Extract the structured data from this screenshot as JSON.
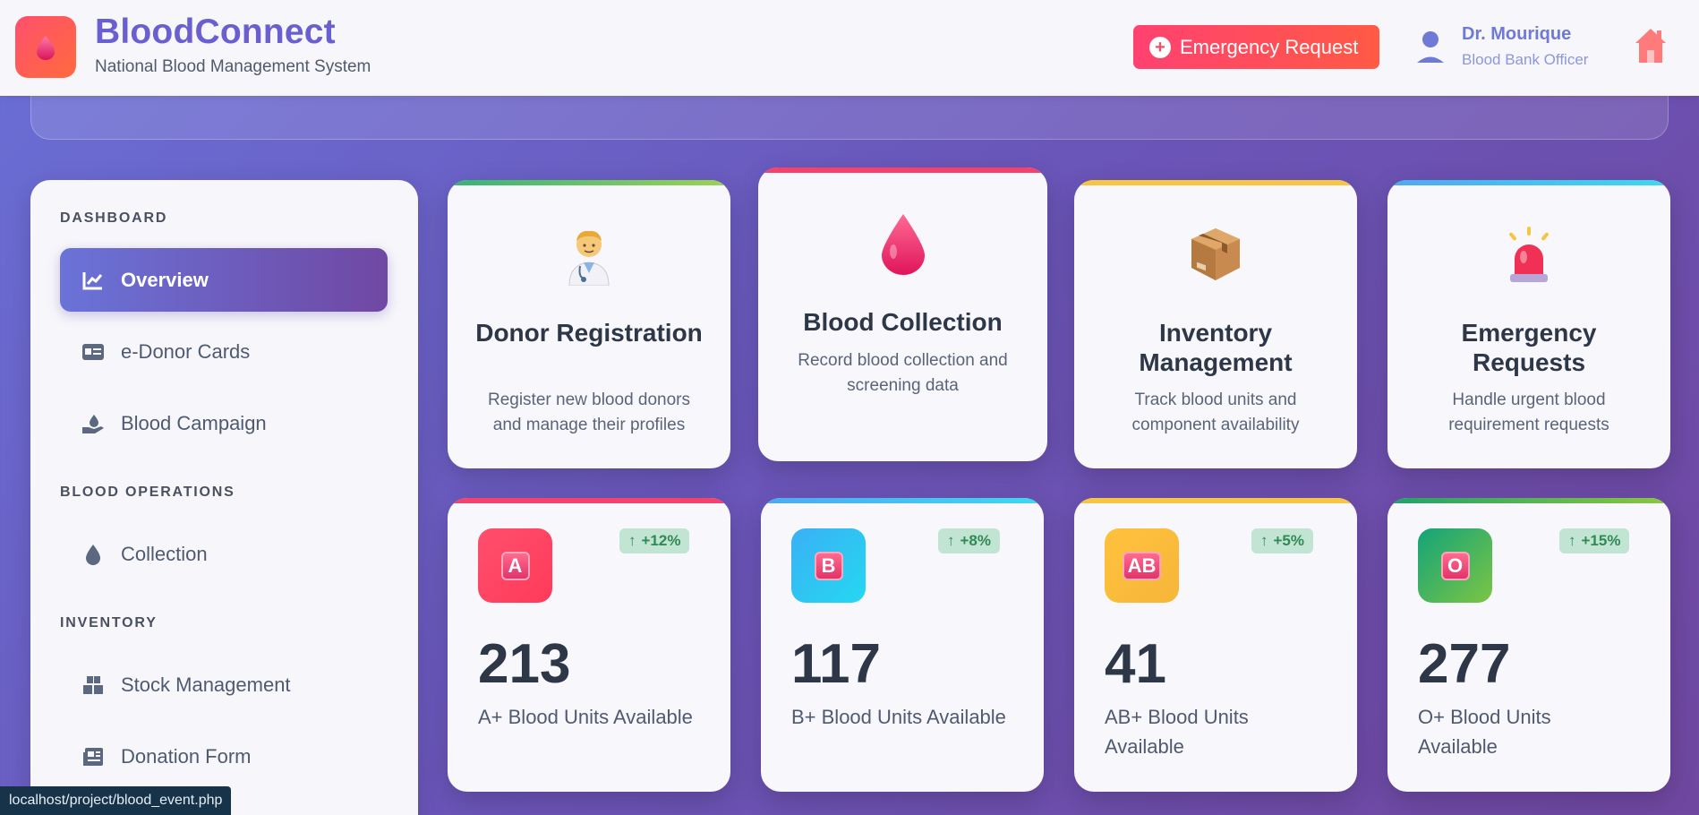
{
  "header": {
    "brand_title": "BloodConnect",
    "brand_subtitle": "National Blood Management System",
    "emergency_label": "Emergency Request",
    "user_name": "Dr. Mourique",
    "user_role": "Blood Bank Officer"
  },
  "sidebar": {
    "sections": [
      {
        "title": "DASHBOARD"
      },
      {
        "title": "BLOOD OPERATIONS"
      },
      {
        "title": "INVENTORY"
      }
    ],
    "items": [
      {
        "label": "Overview",
        "icon": "chart-line-icon",
        "active": true
      },
      {
        "label": "e-Donor Cards",
        "icon": "id-card-icon"
      },
      {
        "label": "Blood Campaign",
        "icon": "hand-holding-droplet-icon"
      },
      {
        "label": "Collection",
        "icon": "droplet-icon"
      },
      {
        "label": "Stock Management",
        "icon": "boxes-icon"
      },
      {
        "label": "Donation Form",
        "icon": "newspaper-icon"
      }
    ]
  },
  "feature_cards": [
    {
      "title": "Donor Registration",
      "desc": "Register new blood donors and manage their profiles",
      "accent": "#48bb78",
      "icon": "doctor-icon"
    },
    {
      "title": "Blood Collection",
      "desc": "Record blood collection and screening data",
      "accent": "#f5426c",
      "icon": "blood-drop-icon"
    },
    {
      "title": "Inventory Management",
      "desc": "Track blood units and component availability",
      "accent": "#f6c544",
      "icon": "package-icon"
    },
    {
      "title": "Emergency Requests",
      "desc": "Handle urgent blood requirement requests",
      "accent": "#4fc3f7",
      "icon": "siren-icon"
    }
  ],
  "stat_cards": [
    {
      "letter": "A",
      "count": "213",
      "label": "A+ Blood Units Available",
      "trend": "+12%",
      "accent": "#f5426c"
    },
    {
      "letter": "B",
      "count": "117",
      "label": "B+ Blood Units Available",
      "trend": "+8%",
      "accent": "#4fb8f0"
    },
    {
      "letter": "AB",
      "count": "41",
      "label": "AB+ Blood Units Available",
      "trend": "+5%",
      "accent": "#f6c544"
    },
    {
      "letter": "O",
      "count": "277",
      "label": "O+ Blood Units Available",
      "trend": "+15%",
      "accent": "#3dbb6f"
    }
  ],
  "status_bar": {
    "url": "localhost/project/blood_event.php"
  }
}
